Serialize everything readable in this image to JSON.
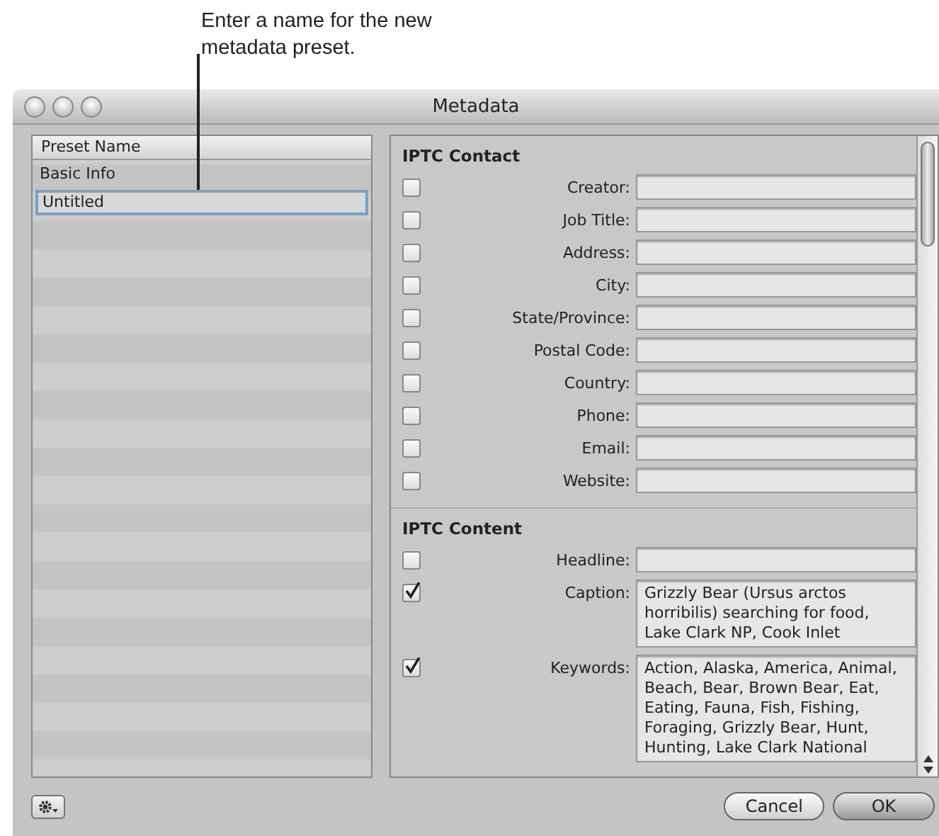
{
  "callout": "Enter a name for the new metadata preset.",
  "window": {
    "title": "Metadata"
  },
  "preset_list": {
    "header": "Preset Name",
    "items": [
      {
        "name": "Basic Info",
        "editing": false
      },
      {
        "name": "Untitled",
        "editing": true
      }
    ]
  },
  "sections": [
    {
      "title": "IPTC Contact",
      "fields": [
        {
          "label": "Creator:",
          "checked": false,
          "kind": "line"
        },
        {
          "label": "Job Title:",
          "checked": false,
          "kind": "line"
        },
        {
          "label": "Address:",
          "checked": false,
          "kind": "line"
        },
        {
          "label": "City:",
          "checked": false,
          "kind": "line"
        },
        {
          "label": "State/Province:",
          "checked": false,
          "kind": "line"
        },
        {
          "label": "Postal Code:",
          "checked": false,
          "kind": "line"
        },
        {
          "label": "Country:",
          "checked": false,
          "kind": "line"
        },
        {
          "label": "Phone:",
          "checked": false,
          "kind": "line"
        },
        {
          "label": "Email:",
          "checked": false,
          "kind": "line"
        },
        {
          "label": "Website:",
          "checked": false,
          "kind": "line"
        }
      ]
    },
    {
      "title": "IPTC Content",
      "fields": [
        {
          "label": "Headline:",
          "checked": false,
          "kind": "line"
        },
        {
          "label": "Caption:",
          "checked": true,
          "kind": "area",
          "value": "Grizzly Bear (Ursus arctos horribilis) searching for food, Lake Clark NP, Cook Inlet"
        },
        {
          "label": "Keywords:",
          "checked": true,
          "kind": "area",
          "value": "Action, Alaska, America, Animal, Beach, Bear, Brown Bear, Eat, Eating, Fauna, Fish, Fishing, Foraging, Grizzly Bear, Hunt, Hunting, Lake Clark National"
        }
      ]
    }
  ],
  "buttons": [
    {
      "label": "Cancel",
      "default": false
    },
    {
      "label": "OK",
      "default": true
    }
  ]
}
